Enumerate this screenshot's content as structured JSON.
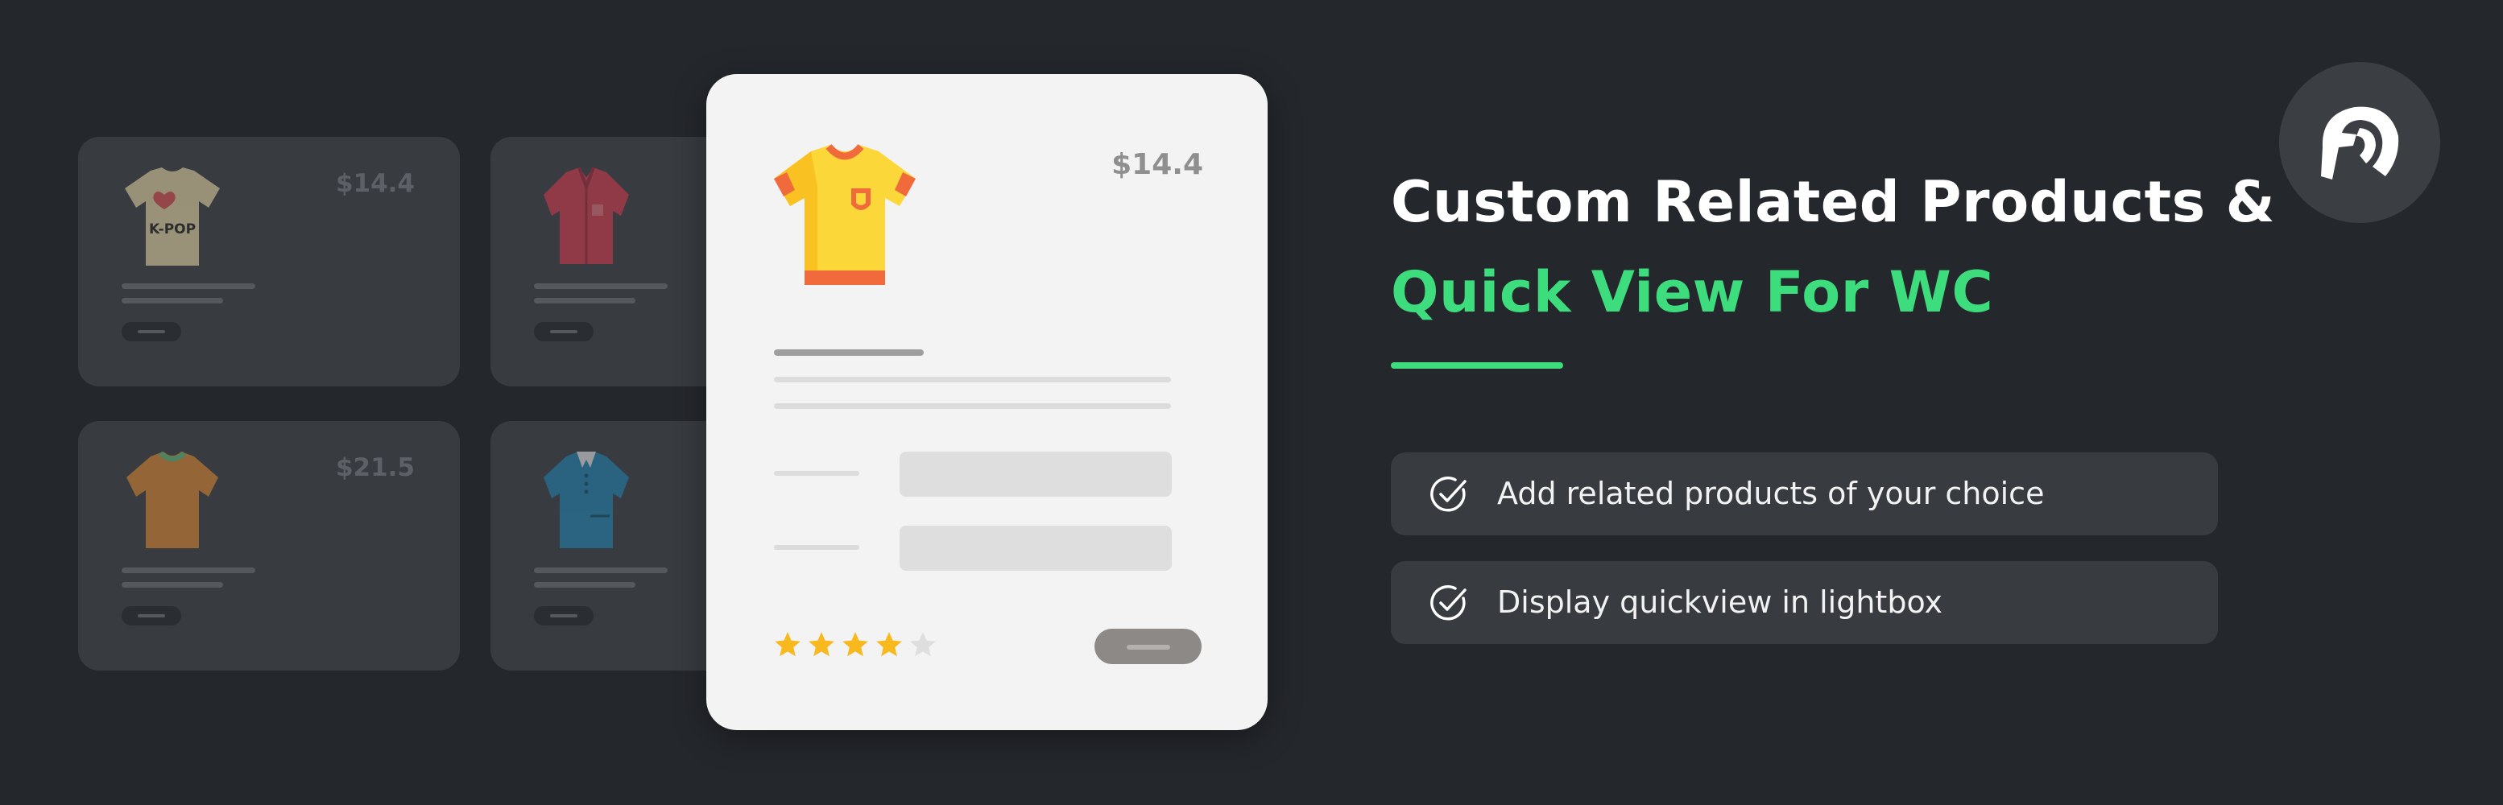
{
  "background_color": "#24272c",
  "accent_color": "#3ddc7c",
  "heading": {
    "line1": "Custom Related Products &",
    "line2": "Quick View For WC"
  },
  "features": [
    {
      "icon": "check-circle-icon",
      "text": "Add related products of your choice"
    },
    {
      "icon": "check-circle-icon",
      "text": "Display quickview in lightbox"
    }
  ],
  "product_cards": [
    {
      "price": "$14.4",
      "shirt": "k-pop-tshirt-icon",
      "shirt_text": "K-POP"
    },
    {
      "price": "",
      "shirt": "red-shirt-icon"
    },
    {
      "price": "$21.5",
      "shirt": "orange-polo-icon"
    },
    {
      "price": "",
      "shirt": "blue-polo-icon"
    }
  ],
  "quick_view": {
    "price": "$14.4",
    "shirt": "yellow-tshirt-icon",
    "rating": 4,
    "rating_max": 5
  },
  "logo": "spartan-helmet-icon"
}
